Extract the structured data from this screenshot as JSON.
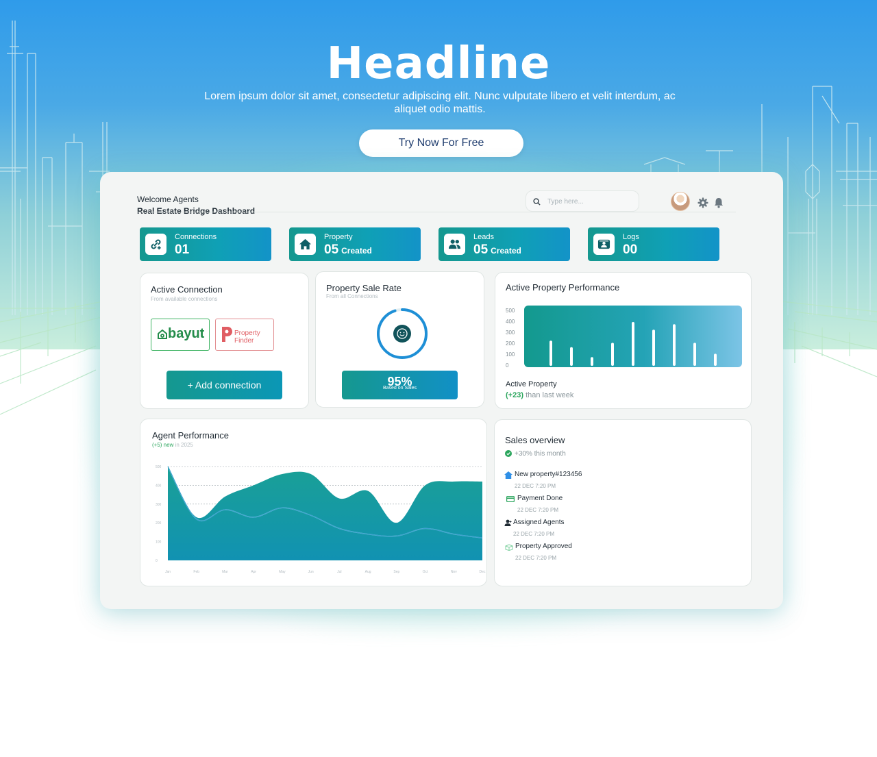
{
  "hero": {
    "headline": "Headline",
    "subtitle": "Lorem ipsum dolor sit amet, consectetur adipiscing elit. Nunc vulputate libero et velit interdum, ac aliquet odio mattis.",
    "cta_label": "Try Now For Free"
  },
  "header": {
    "welcome": "Welcome Agents",
    "title": "Real Estate Bridge Dashboard",
    "search_placeholder": "Type here..."
  },
  "stats": [
    {
      "label": "Connections",
      "value": "01",
      "suffix": "",
      "icon": "link-icon"
    },
    {
      "label": "Property",
      "value": "05",
      "suffix": "Created",
      "icon": "home-icon"
    },
    {
      "label": "Leads",
      "value": "05",
      "suffix": "Created",
      "icon": "users-icon"
    },
    {
      "label": "Logs",
      "value": "00",
      "suffix": "",
      "icon": "id-card-icon"
    }
  ],
  "active_connection": {
    "title": "Active Connection",
    "subtitle": "From available connections",
    "logos": [
      "bayut",
      "Property Finder"
    ],
    "button_label": "+ Add connection"
  },
  "sale_rate": {
    "title": "Property Sale Rate",
    "subtitle": "From all Connections",
    "value": "95%",
    "caption": "Based on Sales",
    "fraction": 0.95
  },
  "property_performance": {
    "title": "Active Property Performance",
    "label": "Active Property",
    "change": "(+23)",
    "change_text": "than last week"
  },
  "agent_performance": {
    "title": "Agent Performance",
    "change": "(+5) new",
    "change_text": "in 2025"
  },
  "sales_overview": {
    "title": "Sales overview",
    "change": "+30% this month",
    "items": [
      {
        "label": "New property#123456",
        "time": "22 DEC 7:20 PM",
        "icon": "home-icon",
        "color": "#2f8fe6"
      },
      {
        "label": "Payment Done",
        "time": "22 DEC 7:20 PM",
        "icon": "card-icon",
        "color": "#2aa55c"
      },
      {
        "label": "Assigned Agents",
        "time": "22 DEC 7:20 PM",
        "icon": "user-icon",
        "color": "#1f2a33"
      },
      {
        "label": "Property Approved",
        "time": "22 DEC 7:20 PM",
        "icon": "box-icon",
        "color": "#7fd1a0"
      }
    ]
  },
  "chart_data": [
    {
      "type": "bar",
      "title": "Active Property Performance",
      "ylim": [
        0,
        500
      ],
      "yticks": [
        0,
        100,
        200,
        300,
        400,
        500
      ],
      "values": [
        230,
        170,
        80,
        210,
        400,
        330,
        380,
        210,
        110
      ],
      "colors": {
        "background_from": "#13998e",
        "background_to": "#7cc4e6",
        "bar": "#ffffff"
      }
    },
    {
      "type": "area",
      "title": "Agent Performance",
      "categories": [
        "Jan",
        "Feb",
        "Mar",
        "Apr",
        "May",
        "Jun",
        "Jul",
        "Aug",
        "Sep",
        "Oct",
        "Nov",
        "Dec"
      ],
      "ylim": [
        0,
        500
      ],
      "yticks": [
        0,
        100,
        200,
        300,
        400,
        500
      ],
      "series": [
        {
          "values": [
            500,
            230,
            340,
            400,
            460,
            460,
            330,
            370,
            200,
            400,
            420,
            420
          ]
        },
        {
          "values": [
            500,
            220,
            270,
            230,
            280,
            240,
            170,
            140,
            130,
            170,
            140,
            120
          ]
        }
      ],
      "colors": {
        "area_top": "#1aa096",
        "area_mid": "#1192b2",
        "line": "#9ce3e4"
      }
    }
  ]
}
